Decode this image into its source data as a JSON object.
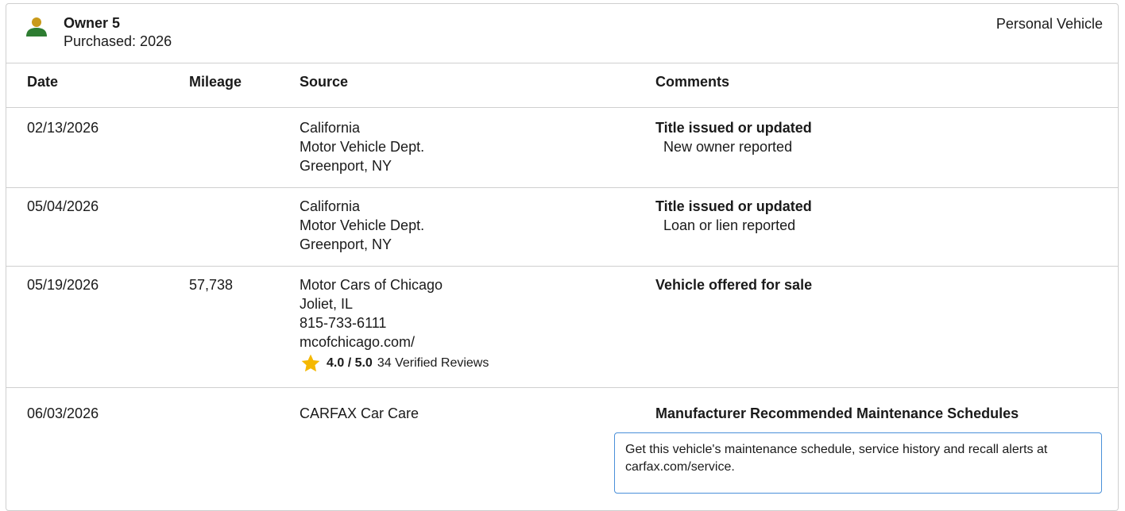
{
  "owner": {
    "name": "Owner 5",
    "purchased": "Purchased: 2026",
    "vehicle_type": "Personal Vehicle",
    "accent_color": "#2e7d32",
    "head_color": "#c99a1a"
  },
  "columns": {
    "date": "Date",
    "mileage": "Mileage",
    "source": "Source",
    "comments": "Comments"
  },
  "records": [
    {
      "date": "02/13/2026",
      "mileage": "",
      "source": [
        "California",
        "Motor Vehicle Dept.",
        "Greenport, NY"
      ],
      "comment_title": "Title issued or updated",
      "comment_detail": "New owner reported"
    },
    {
      "date": "05/04/2026",
      "mileage": "",
      "source": [
        "California",
        "Motor Vehicle Dept.",
        "Greenport, NY"
      ],
      "comment_title": "Title issued or updated",
      "comment_detail": "Loan or lien reported"
    },
    {
      "date": "05/19/2026",
      "mileage": "57,738",
      "source": [
        "Motor Cars of Chicago",
        "Joliet, IL",
        "815-733-6111",
        "mcofchicago.com/"
      ],
      "rating": {
        "score": "4.0 / 5.0",
        "reviews": "34 Verified Reviews",
        "star_color": "#f5b800"
      },
      "comment_title": "Vehicle offered for sale",
      "comment_detail": ""
    },
    {
      "date": "06/03/2026",
      "mileage": "",
      "source": [
        "CARFAX Car Care"
      ],
      "comment_title": "Manufacturer Recommended Maintenance Schedules",
      "comment_detail": "",
      "info_box": "Get this vehicle's maintenance schedule, service history and recall alerts at carfax.com/service."
    }
  ]
}
